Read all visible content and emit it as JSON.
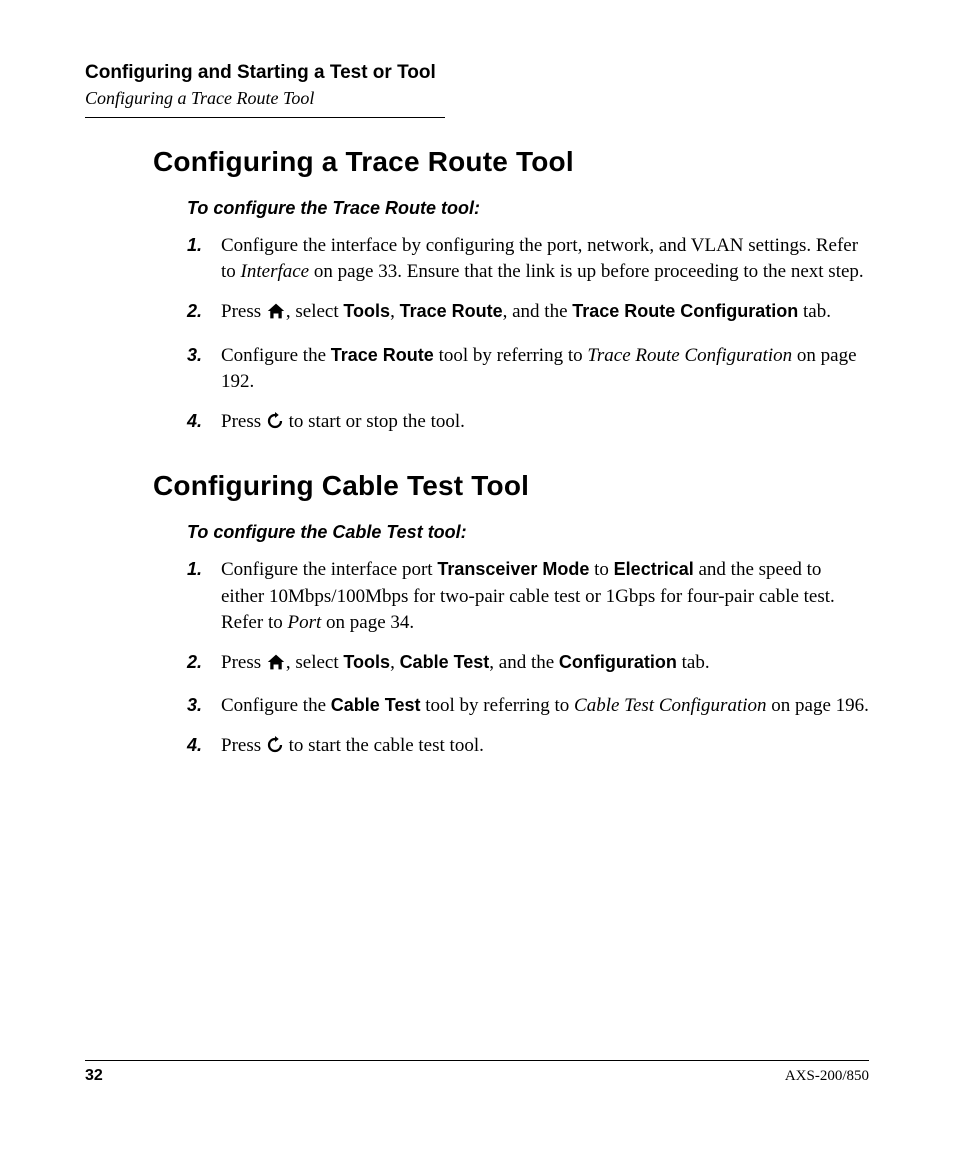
{
  "header": {
    "chapter": "Configuring and Starting a Test or Tool",
    "section": "Configuring a Trace Route Tool"
  },
  "sec1": {
    "title": "Configuring a Trace Route Tool",
    "intro": "To configure the Trace Route tool:",
    "steps": {
      "s1": {
        "n": "1.",
        "a": "Configure the interface by configuring the port, network, and VLAN settings. Refer to ",
        "b": "Interface",
        "c": " on page 33. Ensure that the link is up before proceeding to the next step."
      },
      "s2": {
        "n": "2.",
        "a": "Press ",
        "b": ", select ",
        "c": "Tools",
        "d": ", ",
        "e": "Trace Route",
        "f": ", and the ",
        "g": "Trace Route Configuration",
        "h": " tab."
      },
      "s3": {
        "n": "3.",
        "a": "Configure the ",
        "b": "Trace Route",
        "c": " tool by referring to ",
        "d": "Trace Route Configuration",
        "e": " on page 192."
      },
      "s4": {
        "n": "4.",
        "a": "Press ",
        "b": " to start or stop the tool."
      }
    }
  },
  "sec2": {
    "title": "Configuring Cable Test Tool",
    "intro": "To configure the Cable Test tool:",
    "steps": {
      "s1": {
        "n": "1.",
        "a": "Configure the interface port ",
        "b": "Transceiver Mode",
        "c": " to ",
        "d": "Electrical",
        "e": " and the speed to either 10Mbps/100Mbps for two-pair cable test or 1Gbps for four-pair cable test. Refer to ",
        "f": "Port",
        "g": " on page 34."
      },
      "s2": {
        "n": "2.",
        "a": "Press ",
        "b": ", select ",
        "c": "Tools",
        "d": ", ",
        "e": "Cable Test",
        "f": ", and the ",
        "g": "Configuration",
        "h": " tab."
      },
      "s3": {
        "n": "3.",
        "a": "Configure the ",
        "b": "Cable Test",
        "c": " tool by referring to ",
        "d": "Cable Test Configuration",
        "e": " on page 196."
      },
      "s4": {
        "n": "4.",
        "a": "Press ",
        "b": " to start the cable test tool."
      }
    }
  },
  "footer": {
    "page": "32",
    "model": "AXS-200/850"
  }
}
